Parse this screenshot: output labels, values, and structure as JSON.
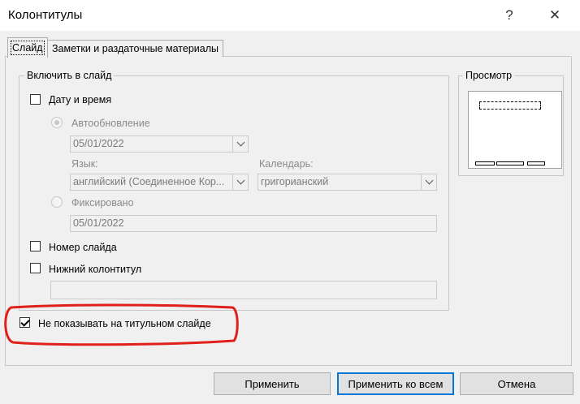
{
  "window": {
    "title": "Колонтитулы",
    "help_glyph": "?",
    "close_glyph": "✕"
  },
  "tabs": [
    {
      "label": "Слайд",
      "active": true
    },
    {
      "label": "Заметки и раздаточные материалы",
      "active": false
    }
  ],
  "include": {
    "legend": "Включить в слайд",
    "datetime_label": "Дату и время",
    "datetime_checked": false,
    "auto_update_label": "Автообновление",
    "auto_update_value": "05/01/2022",
    "language_label": "Язык:",
    "language_value": "английский (Соединенное Кор...",
    "calendar_label": "Календарь:",
    "calendar_value": "григорианский",
    "fixed_label": "Фиксировано",
    "fixed_value": "05/01/2022",
    "slide_number_label": "Номер слайда",
    "slide_number_checked": false,
    "footer_label": "Нижний колонтитул",
    "footer_checked": false,
    "footer_value": ""
  },
  "dont_show_title": {
    "label": "Не показывать на титульном слайде",
    "checked": true
  },
  "preview": {
    "legend": "Просмотр"
  },
  "buttons": {
    "apply": "Применить",
    "apply_all": "Применить ко всем",
    "cancel": "Отмена"
  },
  "colors": {
    "highlight": "#e0201b",
    "default_button_border": "#0078d7"
  }
}
